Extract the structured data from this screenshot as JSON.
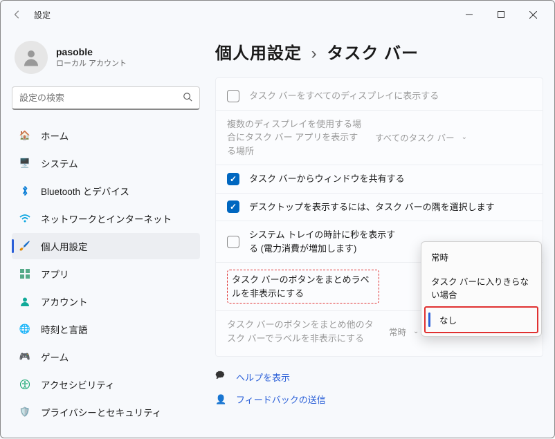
{
  "window": {
    "title": "設定"
  },
  "profile": {
    "name": "pasoble",
    "subtitle": "ローカル アカウント"
  },
  "search": {
    "placeholder": "設定の検索"
  },
  "nav": {
    "home": "ホーム",
    "system": "システム",
    "bluetooth": "Bluetooth とデバイス",
    "network": "ネットワークとインターネット",
    "personal": "個人用設定",
    "apps": "アプリ",
    "accounts": "アカウント",
    "time": "時刻と言語",
    "gaming": "ゲーム",
    "accessibility": "アクセシビリティ",
    "privacy": "プライバシーとセキュリティ"
  },
  "breadcrumb": {
    "root": "個人用設定",
    "leaf": "タスク バー"
  },
  "rows": {
    "showAll": "タスク バーをすべてのディスプレイに表示する",
    "multiDisplay": "複数のディスプレイを使用する場合にタスク バー アプリを表示する場所",
    "multiDisplayValue": "すべてのタスク バー",
    "shareWindow": "タスク バーからウィンドウを共有する",
    "desktopCorner": "デスクトップを表示するには、タスク バーの隅を選択します",
    "showSeconds": "システム トレイの時計に秒を表示する (電力消費が増加します)",
    "combineLabels": "タスク バーのボタンをまとめラベルを非表示にする",
    "combineOther": "タスク バーのボタンをまとめ他のタスク バーでラベルを非表示にする",
    "combineOtherValue": "常時"
  },
  "popup": {
    "opt1": "常時",
    "opt2": "タスク バーに入りきらない場合",
    "opt3": "なし"
  },
  "footer": {
    "help": "ヘルプを表示",
    "feedback": "フィードバックの送信"
  }
}
